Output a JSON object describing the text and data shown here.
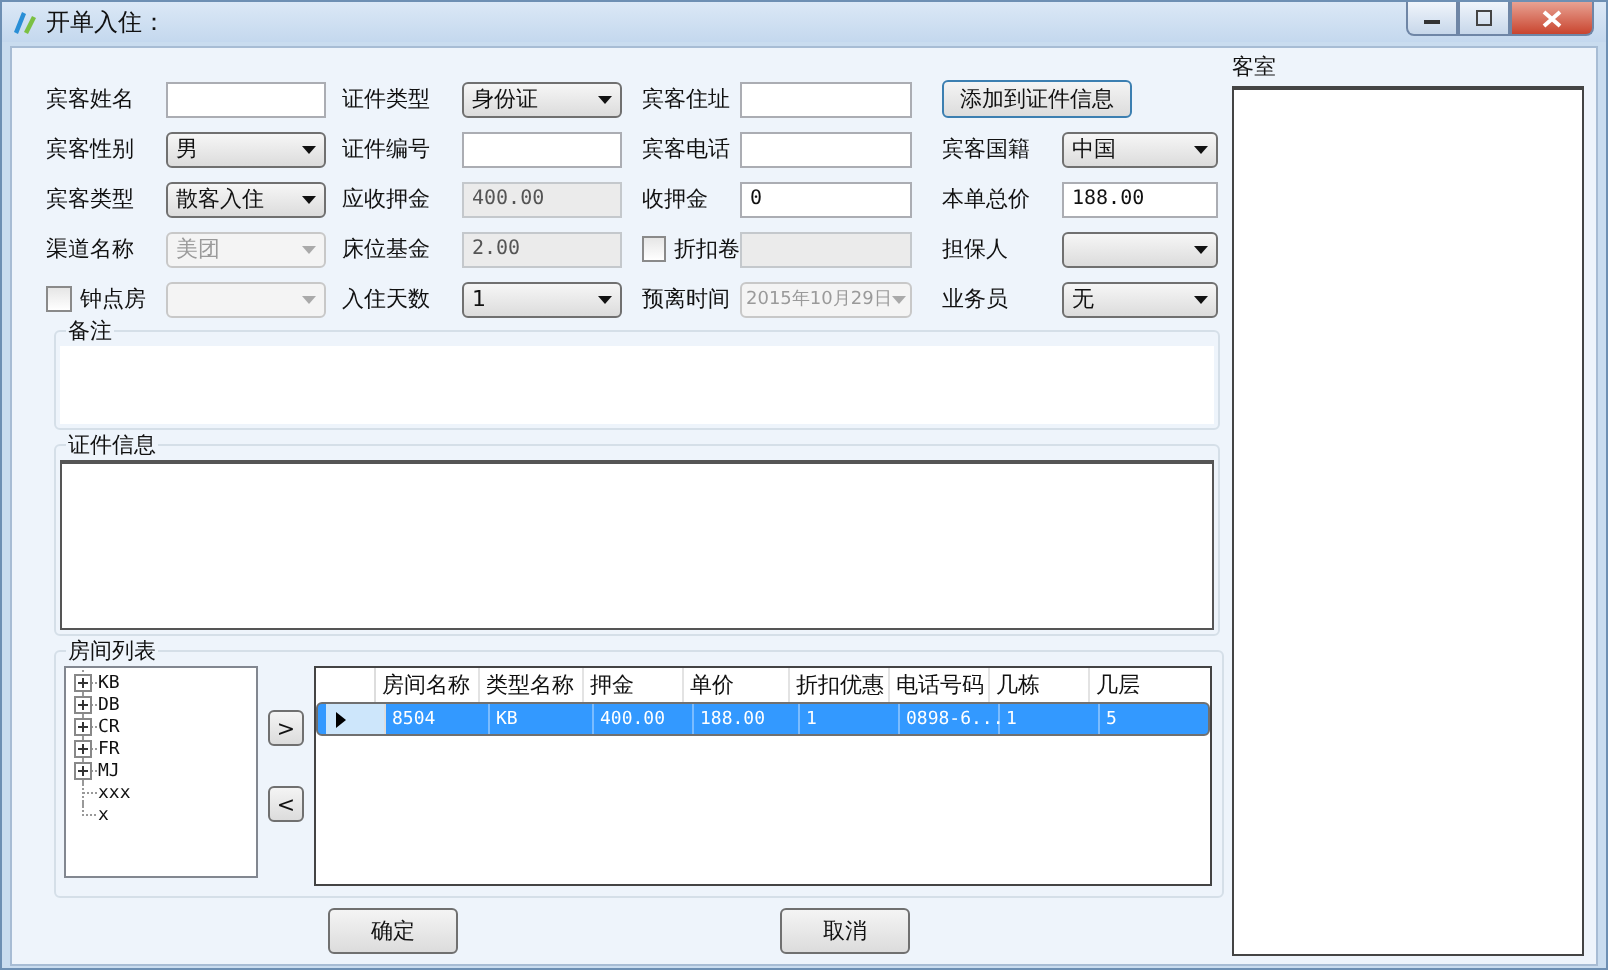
{
  "window": {
    "title": "开单入住："
  },
  "form": {
    "rows": [
      [
        {
          "label": "宾客姓名",
          "kind": "input",
          "disabled": false
        },
        {
          "label": "证件类型",
          "kind": "select",
          "value": "身份证",
          "disabled": false
        },
        {
          "label": "宾客住址",
          "kind": "input",
          "disabled": false
        },
        {
          "kind": "button",
          "value": "添加到证件信息",
          "disabled": false
        }
      ],
      [
        {
          "label": "宾客性别",
          "kind": "select",
          "value": "男",
          "disabled": false
        },
        {
          "label": "证件编号",
          "kind": "input",
          "disabled": false
        },
        {
          "label": "宾客电话",
          "kind": "input",
          "disabled": false
        },
        {
          "label": "宾客国籍",
          "kind": "select",
          "value": "中国",
          "disabled": false
        }
      ],
      [
        {
          "label": "宾客类型",
          "kind": "select",
          "value": "散客入住",
          "disabled": false
        },
        {
          "label": "应收押金",
          "kind": "input",
          "value": "400.00",
          "disabled": true
        },
        {
          "label": "收押金",
          "kind": "input",
          "value": "0",
          "disabled": false
        },
        {
          "label": "本单总价",
          "kind": "input",
          "value": "188.00",
          "disabled": false
        }
      ],
      [
        {
          "label": "渠道名称",
          "kind": "select",
          "value": "美团",
          "disabled": true
        },
        {
          "label": "床位基金",
          "kind": "input",
          "value": "2.00",
          "disabled": true
        },
        {
          "label": "折扣卷",
          "checked": false,
          "kind": "input",
          "disabled": true
        },
        {
          "label": "担保人",
          "kind": "select",
          "disabled": false
        }
      ],
      [
        {
          "label": "钟点房",
          "checked": false,
          "kind": "select",
          "disabled": true
        },
        {
          "label": "入住天数",
          "kind": "select",
          "value": "1",
          "disabled": false
        },
        {
          "label": "预离时间",
          "kind": "select",
          "value": "2015年10月29日",
          "disabled": true
        },
        {
          "label": "业务员",
          "kind": "select",
          "value": "无",
          "disabled": false
        }
      ]
    ]
  },
  "remarks": {
    "title": "备注"
  },
  "id_info": {
    "title": "证件信息"
  },
  "rooms": {
    "title": "房间列表",
    "tree": [
      {
        "label": "KB",
        "kind": "group",
        "expanded": false
      },
      {
        "label": "DB",
        "kind": "group",
        "expanded": false
      },
      {
        "label": "CR",
        "kind": "group",
        "expanded": false
      },
      {
        "label": "FR",
        "kind": "group",
        "expanded": false
      },
      {
        "label": "MJ",
        "kind": "group",
        "expanded": false
      },
      {
        "label": "xxx",
        "kind": "leaf"
      },
      {
        "label": "x",
        "kind": "leaf"
      }
    ],
    "move_buttons": [
      ">",
      "<"
    ],
    "table": {
      "columns": [
        "房间名称",
        "类型名称",
        "押金",
        "单价",
        "折扣优惠",
        "电话号码",
        "几栋",
        "几层"
      ],
      "rows": [
        {
          "selected": true,
          "cells": [
            "8504",
            "KB",
            "400.00",
            "188.00",
            "1",
            "0898-6...",
            "1",
            "5"
          ]
        }
      ]
    }
  },
  "buttons": [
    "确定",
    "取消"
  ],
  "side_panel": {
    "title": "客室"
  }
}
